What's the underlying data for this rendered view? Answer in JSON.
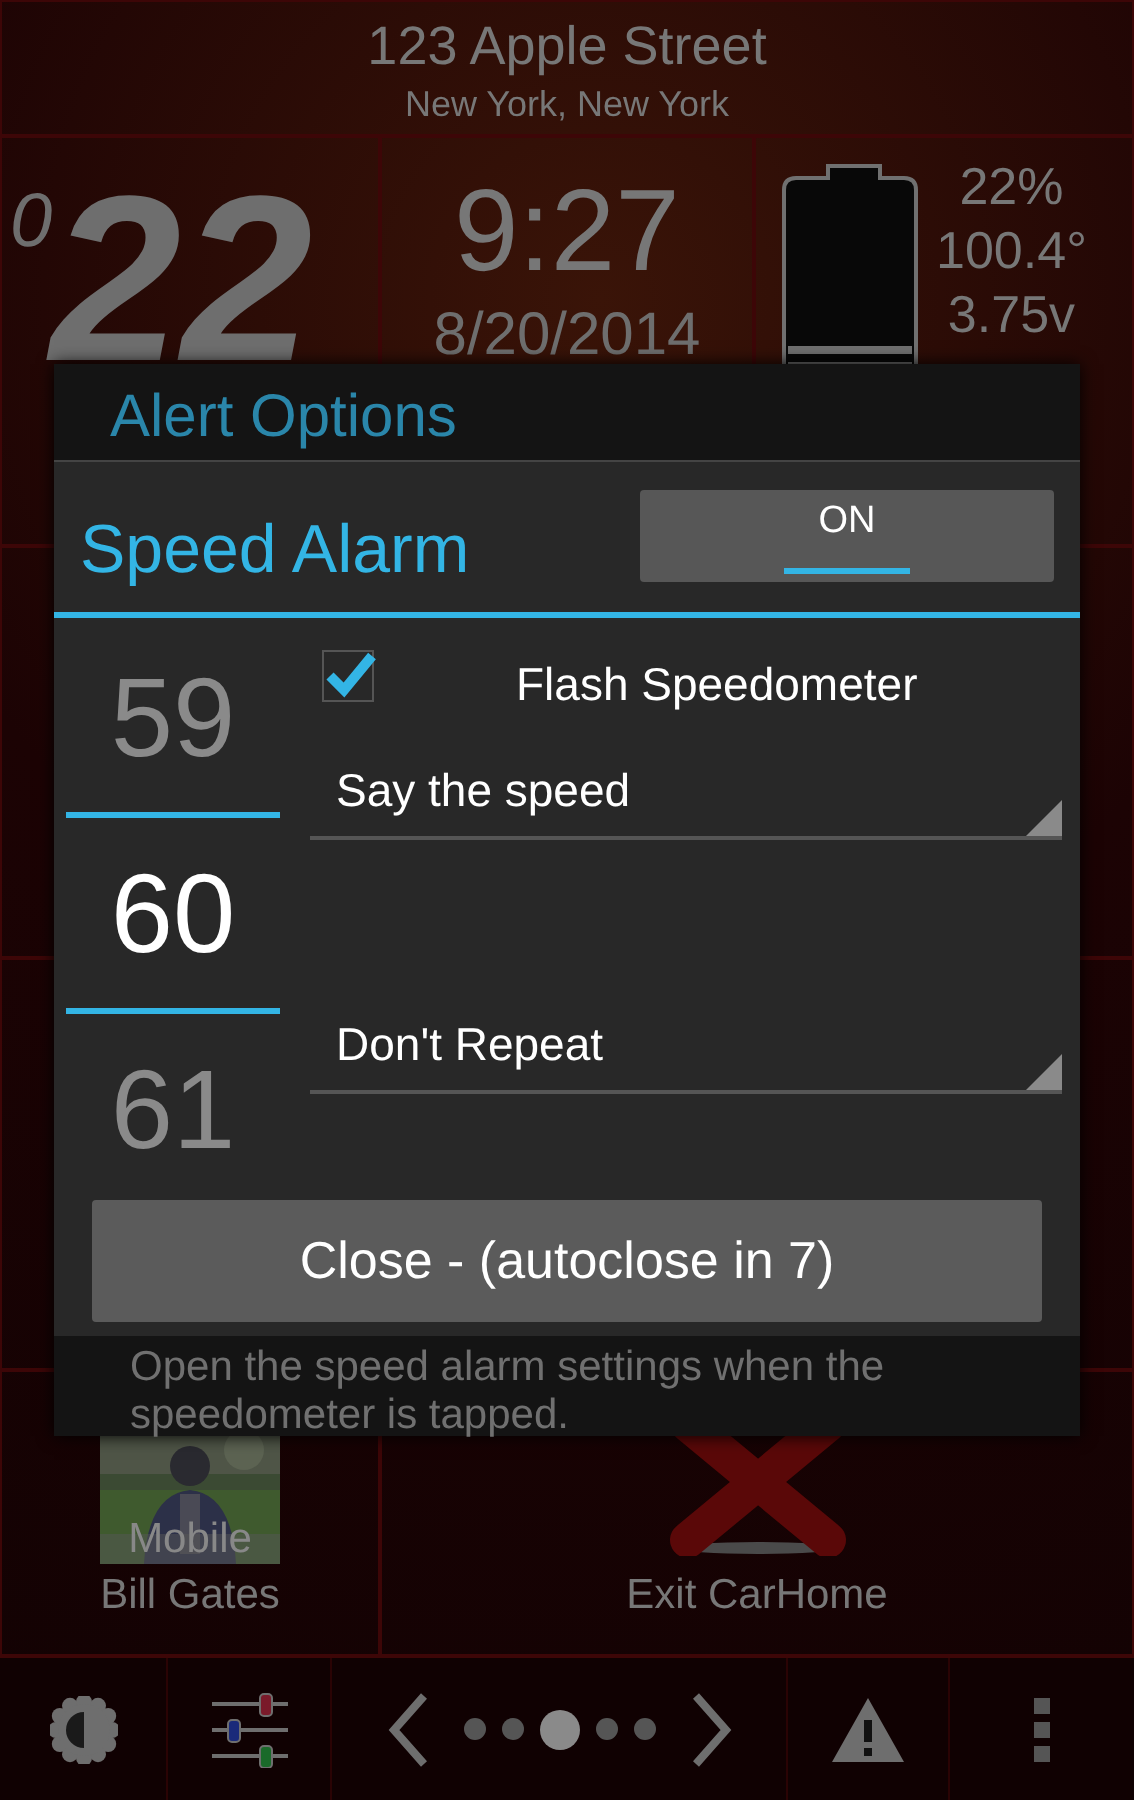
{
  "address": {
    "street": "123 Apple Street",
    "city": "New York, New York"
  },
  "speed": {
    "prefix": "0",
    "value": "22"
  },
  "clock": {
    "time": "9:27",
    "date": "8/20/2014"
  },
  "battery_stats": [
    "22%",
    "100.4°",
    "3.75v"
  ],
  "shortcuts": [
    {
      "kind": "contact",
      "badge": "Mobile",
      "label": "Bill Gates"
    },
    {
      "kind": "exit",
      "label": "Exit CarHome"
    }
  ],
  "back_dialog": {
    "title": "Alert Options",
    "description": "Open the speed alarm settings when the speedometer is tapped."
  },
  "dialog": {
    "title": "Speed Alarm",
    "toggle": {
      "label": "ON",
      "on": true
    },
    "picker": [
      {
        "value": "59",
        "selected": false
      },
      {
        "value": "60",
        "selected": true
      },
      {
        "value": "61",
        "selected": false
      }
    ],
    "flash": {
      "label": "Flash Speedometer",
      "checked": true
    },
    "spinners": [
      "Say the speed",
      "Don't Repeat"
    ],
    "close_button": "Close - (autoclose in 7)"
  },
  "bottom_bar": {
    "pages": [
      {
        "selected": false
      },
      {
        "selected": false
      },
      {
        "selected": true
      },
      {
        "selected": false
      },
      {
        "selected": false
      }
    ]
  }
}
